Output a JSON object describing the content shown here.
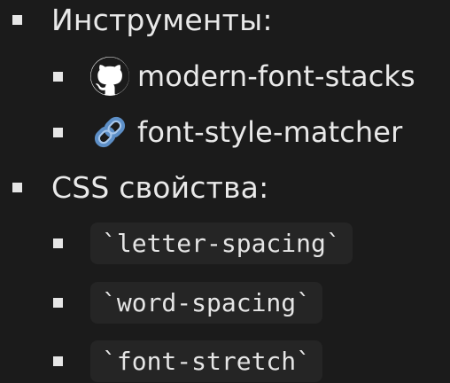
{
  "sections": [
    {
      "title": "Инструменты:",
      "items": [
        {
          "text": "modern-font-stacks",
          "icon": "github-icon"
        },
        {
          "text": "font-style-matcher",
          "icon": "link-icon"
        }
      ]
    },
    {
      "title": "CSS свойства:",
      "items": [
        {
          "text": "`letter-spacing`"
        },
        {
          "text": "`word-spacing`"
        },
        {
          "text": "`font-stretch`"
        }
      ]
    }
  ],
  "colors": {
    "background": "#1b1b1b",
    "text": "#e9e9e9",
    "code_background": "#252525",
    "link_icon_primary": "#5d8fc7",
    "link_icon_light": "#a8c7eb"
  }
}
